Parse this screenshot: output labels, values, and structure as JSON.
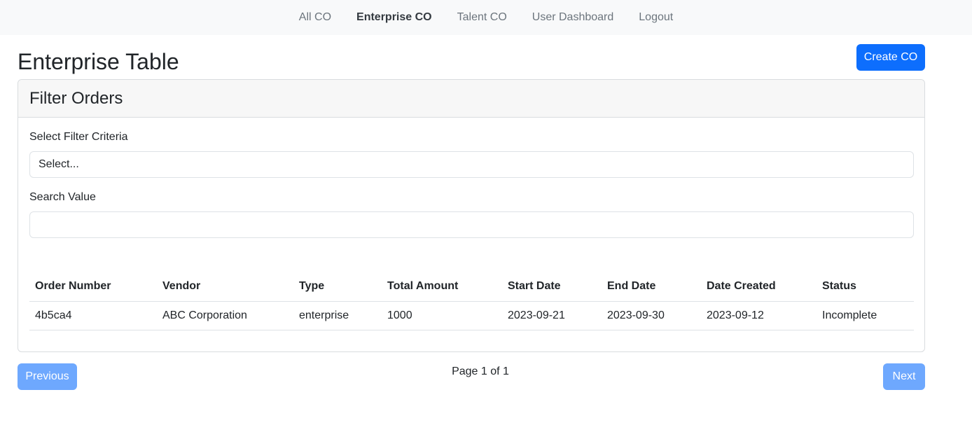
{
  "nav": {
    "items": [
      {
        "label": "All CO",
        "active": false
      },
      {
        "label": "Enterprise CO",
        "active": true
      },
      {
        "label": "Talent CO",
        "active": false
      },
      {
        "label": "User Dashboard",
        "active": false
      },
      {
        "label": "Logout",
        "active": false
      }
    ]
  },
  "page": {
    "title": "Enterprise Table",
    "create_button": "Create CO"
  },
  "filter": {
    "header": "Filter Orders",
    "criteria_label": "Select Filter Criteria",
    "criteria_value": "Select...",
    "search_label": "Search Value",
    "search_value": ""
  },
  "table": {
    "columns": [
      "Order Number",
      "Vendor",
      "Type",
      "Total Amount",
      "Start Date",
      "End Date",
      "Date Created",
      "Status"
    ],
    "rows": [
      {
        "order_number": "4b5ca4",
        "vendor": "ABC Corporation",
        "type": "enterprise",
        "total_amount": "1000",
        "start_date": "2023-09-21",
        "end_date": "2023-09-30",
        "date_created": "2023-09-12",
        "status": "Incomplete"
      }
    ]
  },
  "pagination": {
    "previous_label": "Previous",
    "page_info": "Page 1 of 1",
    "next_label": "Next"
  },
  "colors": {
    "primary": "#0d6efd",
    "primary_disabled": "#6ea8fe",
    "status_incomplete": "#dc3545",
    "nav_background": "#f8f9fa"
  }
}
